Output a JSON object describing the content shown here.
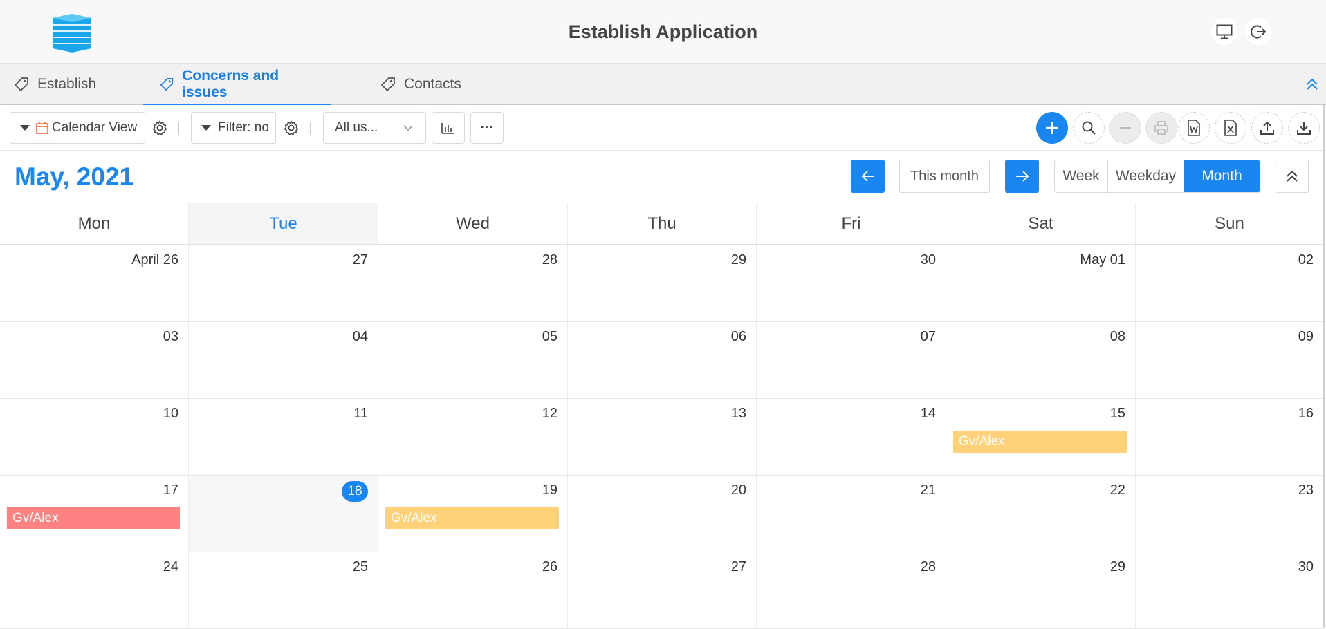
{
  "header": {
    "title": "Establish Application"
  },
  "tabs": [
    {
      "label": "Establish",
      "active": false
    },
    {
      "label": "Concerns and issues",
      "active": true
    },
    {
      "label": "Contacts",
      "active": false
    }
  ],
  "toolbar": {
    "view_label": "Calendar View",
    "filter_label": "Filter: no",
    "user_select": "All us...",
    "more_label": "···"
  },
  "calendar": {
    "month_title": "May, 2021",
    "this_month_label": "This month",
    "views": [
      "Week",
      "Weekday",
      "Month"
    ],
    "active_view": "Month",
    "weekdays": [
      "Mon",
      "Tue",
      "Wed",
      "Thu",
      "Fri",
      "Sat",
      "Sun"
    ],
    "today_column": 1,
    "weeks": [
      [
        "April 26",
        "27",
        "28",
        "29",
        "30",
        "May 01",
        "02"
      ],
      [
        "03",
        "04",
        "05",
        "06",
        "07",
        "08",
        "09"
      ],
      [
        "10",
        "11",
        "12",
        "13",
        "14",
        "15",
        "16"
      ],
      [
        "17",
        "18",
        "19",
        "20",
        "21",
        "22",
        "23"
      ],
      [
        "24",
        "25",
        "26",
        "27",
        "28",
        "29",
        "30"
      ]
    ],
    "events": [
      {
        "label": "Gv/Alex",
        "date": "15",
        "color": "#ffd27a"
      },
      {
        "label": "Gv/Alex",
        "date": "17",
        "color": "#ff8282"
      },
      {
        "label": "Gv/Alex",
        "date": "19",
        "color": "#ffd27a"
      }
    ],
    "today": "18"
  },
  "colors": {
    "accent": "#1a86f0",
    "event_yellow": "#ffd27a",
    "event_red": "#ff8282",
    "calendar_icon": "#ff6a3d"
  }
}
